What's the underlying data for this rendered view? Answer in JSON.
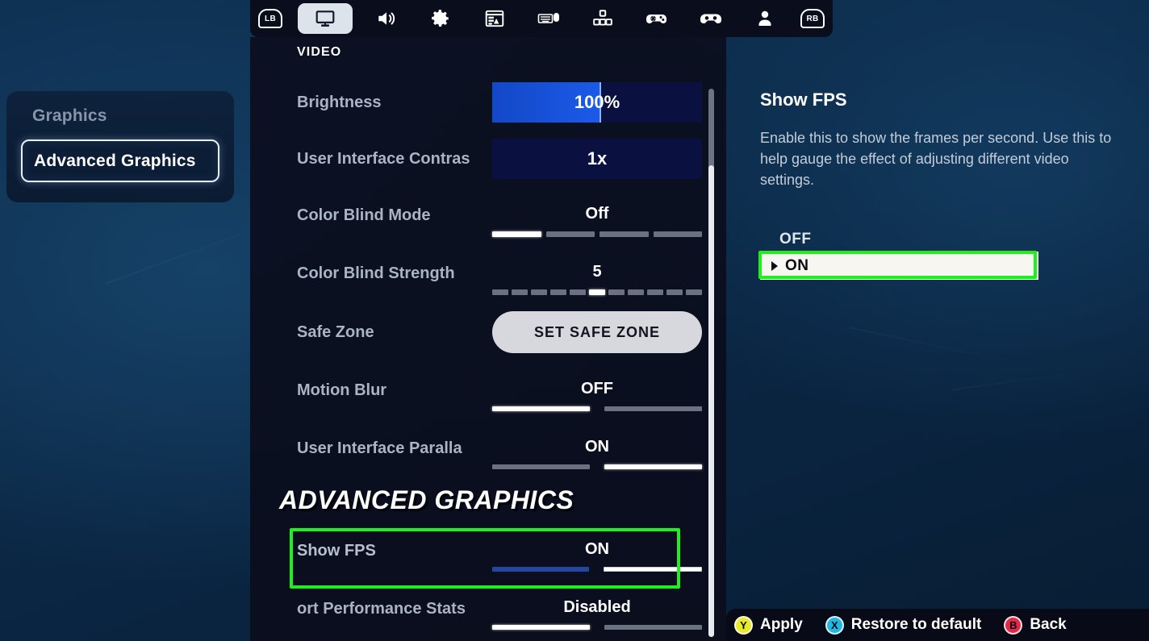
{
  "topbar": {
    "left_bumper": "LB",
    "right_bumper": "RB",
    "tabs": [
      {
        "name": "video",
        "icon": "monitor-icon",
        "selected": true
      },
      {
        "name": "audio",
        "icon": "speaker-icon",
        "selected": false
      },
      {
        "name": "game",
        "icon": "gear-icon",
        "selected": false
      },
      {
        "name": "brightness-ui",
        "icon": "ui-layout-icon",
        "selected": false
      },
      {
        "name": "keyboard-mouse",
        "icon": "keyboard-mouse-icon",
        "selected": false
      },
      {
        "name": "keybinds",
        "icon": "keybinds-icon",
        "selected": false
      },
      {
        "name": "controller-options",
        "icon": "controller-gear-icon",
        "selected": false
      },
      {
        "name": "controller",
        "icon": "gamepad-icon",
        "selected": false
      },
      {
        "name": "account",
        "icon": "person-icon",
        "selected": false
      }
    ]
  },
  "sidebar": {
    "items": [
      {
        "label": "Graphics",
        "selected": false
      },
      {
        "label": "Advanced Graphics",
        "selected": true
      }
    ]
  },
  "settings": {
    "section_label": "VIDEO",
    "rows": [
      {
        "label": "Brightness",
        "value": "100%",
        "control": "fill-bar",
        "fill_percent": 52
      },
      {
        "label": "User Interface Contras",
        "value": "1x",
        "control": "fill-bar",
        "fill_percent": 0
      },
      {
        "label": "Color Blind Mode",
        "value": "Off",
        "control": "segments",
        "segment_count": 4,
        "active_index": 0
      },
      {
        "label": "Color Blind Strength",
        "value": "5",
        "control": "segments",
        "segment_count": 11,
        "active_index": 5
      },
      {
        "label": "Safe Zone",
        "value": "SET SAFE ZONE",
        "control": "button"
      },
      {
        "label": "Motion Blur",
        "value": "OFF",
        "control": "segments",
        "segment_count": 2,
        "active_index": 0
      },
      {
        "label": "User Interface Paralla",
        "value": "ON",
        "control": "segments",
        "segment_count": 2,
        "active_index": 1
      }
    ],
    "advanced_header": "ADVANCED GRAPHICS",
    "advanced_rows": [
      {
        "label": "Show FPS",
        "value": "ON",
        "control": "segments",
        "segment_count": 2,
        "active_index": 1,
        "highlighted": true
      },
      {
        "label": "ort Performance Stats",
        "value": "Disabled",
        "control": "segments",
        "segment_count": 2,
        "active_index": 0
      }
    ]
  },
  "detail": {
    "title": "Show FPS",
    "description": "Enable this to show the frames per second. Use this to help gauge the effect of adjusting different video settings.",
    "option_off": "OFF",
    "option_on": "ON",
    "selected_option": "ON"
  },
  "bottom_actions": [
    {
      "button": "Y",
      "label": "Apply",
      "color": "#e8ea2a"
    },
    {
      "button": "X",
      "label": "Restore to default",
      "color": "#21b7e0"
    },
    {
      "button": "B",
      "label": "Back",
      "color": "#e02a4a"
    }
  ],
  "highlight_color": "#1ef01e"
}
